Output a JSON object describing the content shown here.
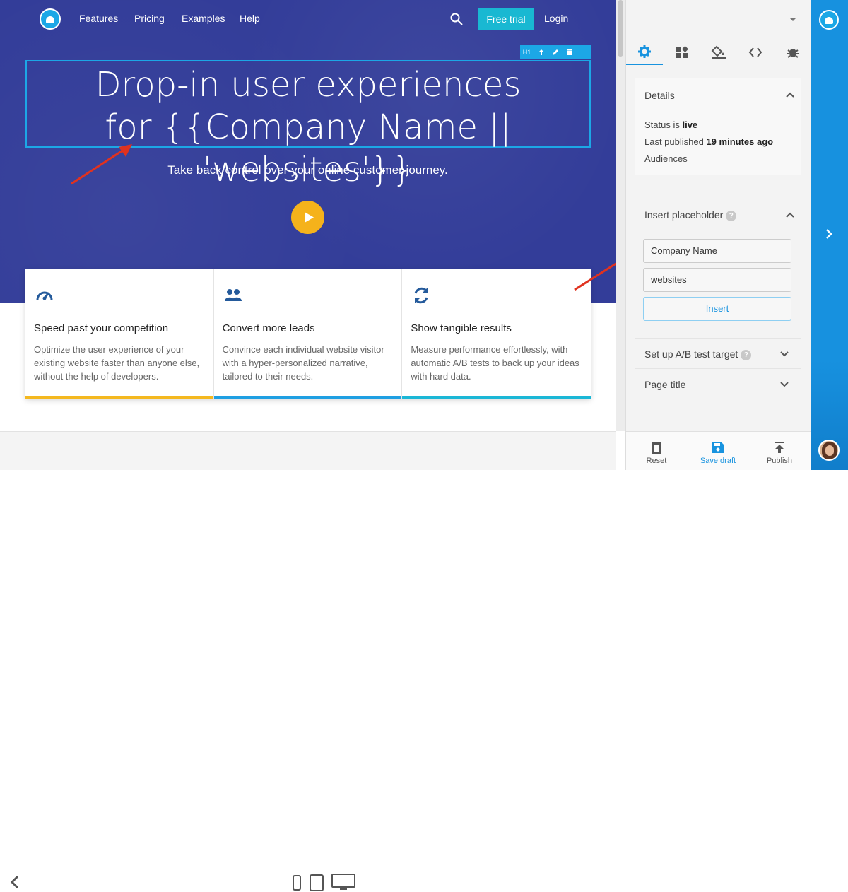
{
  "nav": {
    "features": "Features",
    "pricing": "Pricing",
    "examples": "Examples",
    "help": "Help",
    "free_trial": "Free trial",
    "login": "Login"
  },
  "element_toolbar": {
    "tag": "H1"
  },
  "hero": {
    "headline_line1": "Drop-in user experiences",
    "headline_line2": "for {{Company Name || 'websites'}}",
    "subheadline": "Take back control over your online customer journey."
  },
  "features": [
    {
      "title": "Speed past your competition",
      "text": "Optimize the user experience of your existing website faster than anyone else, without the help of developers.",
      "icon": "speedometer-icon",
      "color": "#f4b81f"
    },
    {
      "title": "Convert more leads",
      "text": "Convince each individual website visitor with a hyper-personalized narrative, tailored to their needs.",
      "icon": "users-icon",
      "color": "#1f9fe2"
    },
    {
      "title": "Show tangible results",
      "text": "Measure performance effortlessly, with automatic A/B tests to back up your ideas with hard data.",
      "icon": "refresh-icon",
      "color": "#1bb7d6"
    }
  ],
  "panel": {
    "tabs": [
      "settings-icon",
      "widgets-icon",
      "paint-bucket-icon",
      "code-icon",
      "bug-icon"
    ],
    "details": {
      "title": "Details",
      "status_prefix": "Status is ",
      "status_value": "live",
      "published_prefix": "Last published ",
      "published_value": "19 minutes ago",
      "audiences": "Audiences"
    },
    "placeholder": {
      "title": "Insert placeholder",
      "field1": "Company Name",
      "field2": "websites",
      "insert": "Insert"
    },
    "ab_test": {
      "title": "Set up A/B test target"
    },
    "page_title": {
      "title": "Page title"
    },
    "bottom": {
      "reset": "Reset",
      "save_draft": "Save draft",
      "publish": "Publish"
    }
  },
  "colors": {
    "hero_bg": "#333d99",
    "accent": "#1893df",
    "cta": "#19b8d2",
    "play": "#f5b21b",
    "annotation_arrow": "#e0321f"
  }
}
